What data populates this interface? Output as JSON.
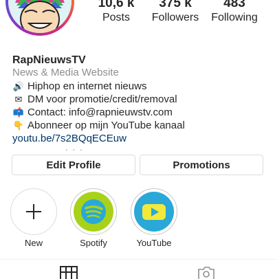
{
  "profile": {
    "username": "RapNieuwsTV",
    "category": "News & Media Website",
    "bio": [
      {
        "icon": "speaker-emoji",
        "glyph": "🔊",
        "text": "Hiphop en internet nieuws"
      },
      {
        "icon": "envelope-emoji",
        "glyph": "✉",
        "text": "DM voor promotie/credit/removal"
      },
      {
        "icon": "mailbox-emoji",
        "glyph": "📫",
        "text": "Contact: info@rapnieuwstv.com"
      },
      {
        "icon": "pointing-down-emoji",
        "glyph": "👇",
        "text": "Abonneer op mijn YouTube kanaal"
      }
    ],
    "link": "youtu.be/7s2BQqECEuw"
  },
  "stats": {
    "posts": {
      "value": "10,6 k",
      "label": "Posts"
    },
    "followers": {
      "value": "375 k",
      "label": "Followers"
    },
    "following": {
      "value": "483",
      "label": "Following"
    }
  },
  "buttons": {
    "edit_profile": "Edit Profile",
    "promotions": "Promotions"
  },
  "highlights": [
    {
      "label": "New",
      "icon": "plus-icon"
    },
    {
      "label": "Spotify",
      "icon": "spotify-icon"
    },
    {
      "label": "YouTube",
      "icon": "youtube-icon"
    }
  ],
  "tabs": [
    {
      "icon": "grid-icon"
    },
    {
      "icon": "tagged-photos-icon"
    }
  ],
  "colors": {
    "link": "#003569",
    "secondary_text": "#8e8e8e",
    "border": "#dbdbdb",
    "spotify_bg": "#a8d21a",
    "youtube_bg": "#2aa8d8",
    "youtube_play": "#f2e93a"
  }
}
